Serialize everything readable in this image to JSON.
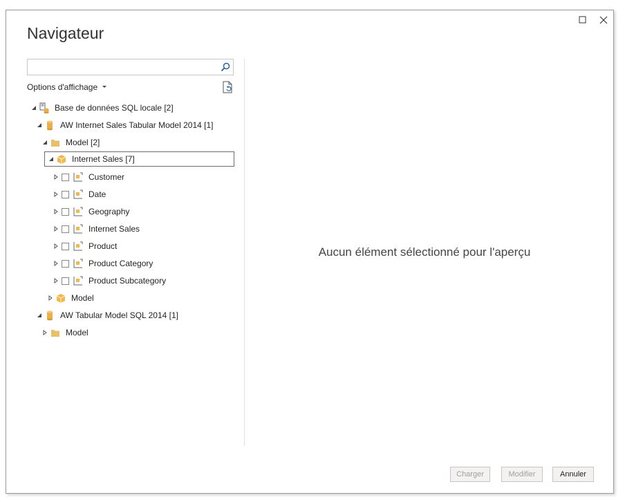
{
  "dialog": {
    "title": "Navigateur",
    "window_controls": [
      "maximize-icon",
      "close-icon"
    ]
  },
  "search": {
    "placeholder": "",
    "value": ""
  },
  "display_options": {
    "label": "Options d'affichage"
  },
  "tree": [
    {
      "label": "Base de données SQL locale [2]",
      "icon": "server-database-icon",
      "state": "expanded"
    },
    {
      "label": "AW Internet Sales Tabular Model 2014 [1]",
      "icon": "database-icon",
      "state": "expanded"
    },
    {
      "label": "Model [2]",
      "icon": "folder-icon",
      "state": "expanded"
    },
    {
      "label": "Internet Sales [7]",
      "icon": "cube-icon",
      "state": "expanded",
      "selected": true
    },
    {
      "label": "Customer",
      "icon": "table-icon",
      "state": "collapsed",
      "checked": false
    },
    {
      "label": "Date",
      "icon": "table-icon",
      "state": "collapsed",
      "checked": false
    },
    {
      "label": "Geography",
      "icon": "table-icon",
      "state": "collapsed",
      "checked": false
    },
    {
      "label": "Internet Sales",
      "icon": "table-icon",
      "state": "collapsed",
      "checked": false
    },
    {
      "label": "Product",
      "icon": "table-icon",
      "state": "collapsed",
      "checked": false
    },
    {
      "label": "Product Category",
      "icon": "table-icon",
      "state": "collapsed",
      "checked": false
    },
    {
      "label": "Product Subcategory",
      "icon": "table-icon",
      "state": "collapsed",
      "checked": false
    },
    {
      "label": "Model",
      "icon": "cube-icon",
      "state": "collapsed"
    },
    {
      "label": "AW Tabular Model SQL 2014 [1]",
      "icon": "database-icon",
      "state": "expanded"
    },
    {
      "label": "Model",
      "icon": "folder-icon",
      "state": "collapsed"
    }
  ],
  "preview": {
    "empty_message": "Aucun élément sélectionné pour l'aperçu"
  },
  "footer": {
    "load_label": "Charger",
    "edit_label": "Modifier",
    "cancel_label": "Annuler"
  },
  "colors": {
    "folder": "#E8C06A",
    "cube": "#F2B84B",
    "database": "#E8B04E",
    "border": "#9A9A9A",
    "disabled_text": "#A19F9D"
  }
}
